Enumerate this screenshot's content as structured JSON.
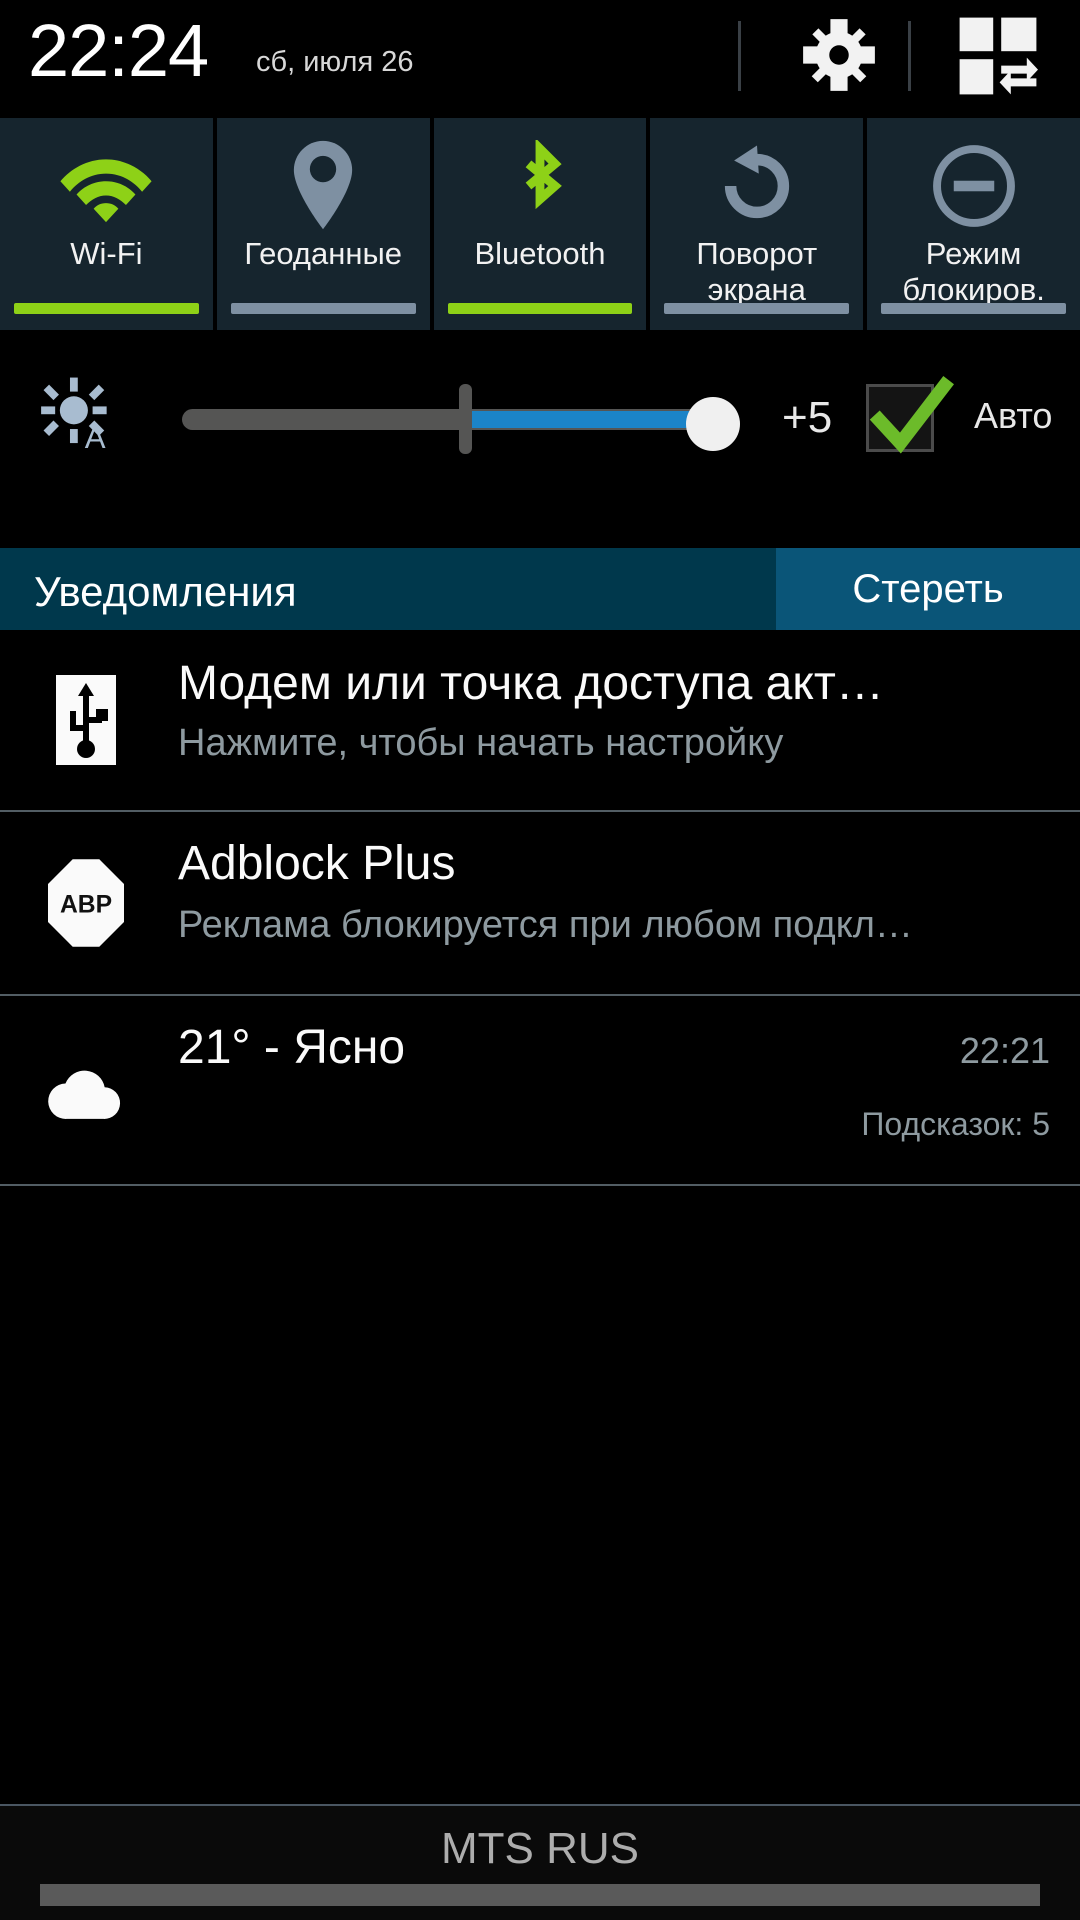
{
  "status_bar": {
    "time": "22:24",
    "date": "сб, июля 26",
    "settings_icon": "gear-icon",
    "quick_settings_icon": "quick-settings-grid-icon"
  },
  "quick_toggles": {
    "tiles": [
      {
        "label": "Wi-Fi",
        "icon": "wifi-icon",
        "state": "on",
        "accent": "#8ed117"
      },
      {
        "label": "Геоданные",
        "icon": "location-pin-icon",
        "state": "off",
        "accent": "#7e90a2"
      },
      {
        "label": "Bluetooth",
        "icon": "bluetooth-icon",
        "state": "on",
        "accent": "#8ed117"
      },
      {
        "label": "Поворот\nэкрана",
        "icon": "screen-rotate-icon",
        "state": "off",
        "accent": "#7e90a2"
      },
      {
        "label": "Режим\nблокиров.",
        "icon": "blocking-mode-icon",
        "state": "off",
        "accent": "#7e90a2"
      }
    ]
  },
  "brightness": {
    "icon": "brightness-auto-icon",
    "value_label": "+5",
    "auto_label": "Авто",
    "auto_checked": true,
    "slider_fill_color": "#1b84c8",
    "slider_track_color": "#555554"
  },
  "notifications_header": {
    "title": "Уведомления",
    "clear_label": "Стереть",
    "bar_color": "#00384c",
    "clear_color": "#0a5578"
  },
  "notifications": [
    {
      "icon": "usb-tethering-icon",
      "title": "Модем или точка доступа акт…",
      "subtitle": "Нажмите, чтобы начать настройку",
      "time": "",
      "extra": ""
    },
    {
      "icon": "adblock-plus-icon",
      "title": "Adblock Plus",
      "subtitle": "Реклама блокируется при любом подкл…",
      "time": "",
      "extra": ""
    },
    {
      "icon": "weather-cloud-icon",
      "title": "21° - Ясно",
      "subtitle": "",
      "time": "22:21",
      "extra": "Подсказок: 5"
    }
  ],
  "carrier_bar": {
    "label": "MTS RUS"
  }
}
